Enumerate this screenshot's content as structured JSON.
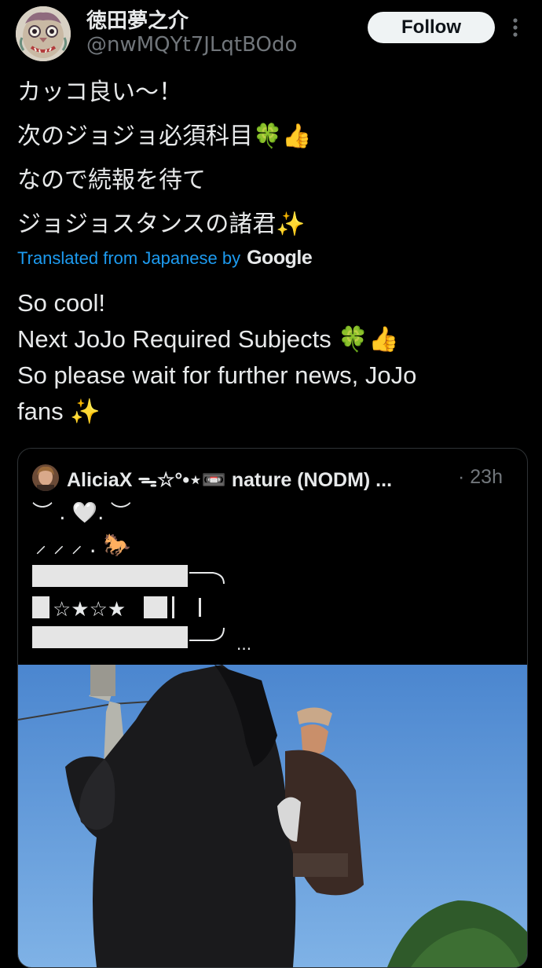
{
  "author": {
    "display_name": "徳田夢之介",
    "handle": "@nwMQYt7JLqtBOdo",
    "avatar_icon": "demon-mask-avatar"
  },
  "follow_button": {
    "label": "Follow"
  },
  "more_icon": "vertical-ellipsis-icon",
  "original_text": [
    "カッコ良い～！",
    "次のジョジョ必須科目🍀👍",
    "なので続報を待て",
    "ジョジョスタンスの諸君✨"
  ],
  "translation": {
    "label": "Translated from Japanese by",
    "provider": "Google"
  },
  "translated_text": [
    "So cool!",
    "Next JoJo Required Subjects 🍀👍",
    "So please wait for further news, JoJo",
    "fans ✨"
  ],
  "quoted_post": {
    "display_name": "AliciaX ᯓ☆°•⋆📼 nature (NODM) ...",
    "time": "· 23h",
    "ascii_art": {
      "row1": "︶ . 🤍. ︶",
      "row2": "⸝ ⸝ ⸝ . 🐎",
      "row3_stars": "☆★☆★",
      "ellipsis": "..."
    },
    "media_description_icon": "rearing-black-horse-photo"
  },
  "colors": {
    "background": "#000000",
    "text": "#e7e9ea",
    "secondary": "#71767b",
    "link": "#1d9bf0",
    "button_bg": "#eff3f4"
  }
}
